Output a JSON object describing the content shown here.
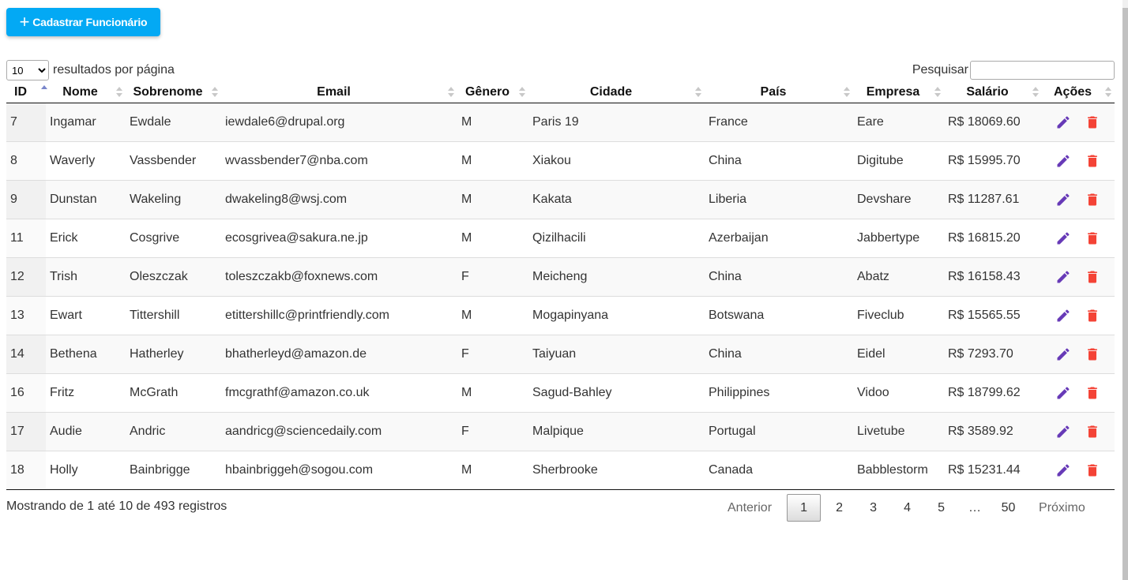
{
  "toolbar": {
    "add_label": "Cadastrar Funcionário"
  },
  "length": {
    "selected": "10",
    "suffix": "resultados por página"
  },
  "search": {
    "label": "Pesquisar",
    "value": ""
  },
  "columns": [
    "ID",
    "Nome",
    "Sobrenome",
    "Email",
    "Gênero",
    "Cidade",
    "País",
    "Empresa",
    "Salário",
    "Ações"
  ],
  "sorted_column": "ID",
  "rows": [
    [
      "7",
      "Ingamar",
      "Ewdale",
      "iewdale6@drupal.org",
      "M",
      "Paris 19",
      "France",
      "Eare",
      "R$ 18069.60"
    ],
    [
      "8",
      "Waverly",
      "Vassbender",
      "wvassbender7@nba.com",
      "M",
      "Xiakou",
      "China",
      "Digitube",
      "R$ 15995.70"
    ],
    [
      "9",
      "Dunstan",
      "Wakeling",
      "dwakeling8@wsj.com",
      "M",
      "Kakata",
      "Liberia",
      "Devshare",
      "R$ 11287.61"
    ],
    [
      "11",
      "Erick",
      "Cosgrive",
      "ecosgrivea@sakura.ne.jp",
      "M",
      "Qizilhacili",
      "Azerbaijan",
      "Jabbertype",
      "R$ 16815.20"
    ],
    [
      "12",
      "Trish",
      "Oleszczak",
      "toleszczakb@foxnews.com",
      "F",
      "Meicheng",
      "China",
      "Abatz",
      "R$ 16158.43"
    ],
    [
      "13",
      "Ewart",
      "Tittershill",
      "etittershillc@printfriendly.com",
      "M",
      "Mogapinyana",
      "Botswana",
      "Fiveclub",
      "R$ 15565.55"
    ],
    [
      "14",
      "Bethena",
      "Hatherley",
      "bhatherleyd@amazon.de",
      "F",
      "Taiyuan",
      "China",
      "Eidel",
      "R$ 7293.70"
    ],
    [
      "16",
      "Fritz",
      "McGrath",
      "fmcgrathf@amazon.co.uk",
      "M",
      "Sagud-Bahley",
      "Philippines",
      "Vidoo",
      "R$ 18799.62"
    ],
    [
      "17",
      "Audie",
      "Andric",
      "aandricg@sciencedaily.com",
      "F",
      "Malpique",
      "Portugal",
      "Livetube",
      "R$ 3589.92"
    ],
    [
      "18",
      "Holly",
      "Bainbrigge",
      "hbainbriggeh@sogou.com",
      "M",
      "Sherbrooke",
      "Canada",
      "Babblestorm",
      "R$ 15231.44"
    ]
  ],
  "row_actions": {
    "edit_icon": "pencil-icon",
    "delete_icon": "trash-icon"
  },
  "info": "Mostrando de 1 até 10 de 493 registros",
  "pagination": {
    "prev": "Anterior",
    "pages": [
      "1",
      "2",
      "3",
      "4",
      "5"
    ],
    "ellipsis": "…",
    "last": "50",
    "next": "Próximo",
    "current": "1"
  },
  "colors": {
    "primary": "#03a9f4",
    "edit": "#673ab7",
    "delete": "#f44336"
  }
}
